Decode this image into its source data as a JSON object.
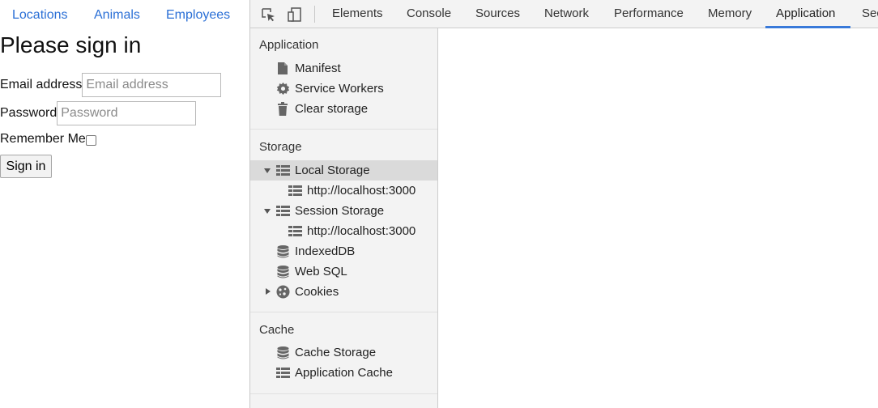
{
  "webpage": {
    "nav": [
      {
        "label": "Locations"
      },
      {
        "label": "Animals"
      },
      {
        "label": "Employees"
      }
    ],
    "title": "Please sign in",
    "email": {
      "label": "Email address",
      "placeholder": "Email address"
    },
    "password": {
      "label": "Password",
      "placeholder": "Password"
    },
    "remember": {
      "label": "Remember Me",
      "checked": false
    },
    "signin_label": "Sign in",
    "link_color": "#2a6fd6"
  },
  "devtools": {
    "tabs": [
      "Elements",
      "Console",
      "Sources",
      "Network",
      "Performance",
      "Memory",
      "Application",
      "Sec"
    ],
    "active_tab": "Application",
    "accent_color": "#3879d9",
    "sidebar": {
      "sections": [
        {
          "title": "Application",
          "items": [
            {
              "label": "Manifest",
              "icon": "document-icon"
            },
            {
              "label": "Service Workers",
              "icon": "gear-icon"
            },
            {
              "label": "Clear storage",
              "icon": "trash-icon"
            }
          ]
        },
        {
          "title": "Storage",
          "items": [
            {
              "label": "Local Storage",
              "icon": "table-grid-icon",
              "expanded": true,
              "selected": true
            },
            {
              "label": "http://localhost:3000",
              "icon": "table-grid-icon"
            },
            {
              "label": "Session Storage",
              "icon": "table-grid-icon",
              "expanded": true
            },
            {
              "label": "http://localhost:3000",
              "icon": "table-grid-icon"
            },
            {
              "label": "IndexedDB",
              "icon": "database-icon"
            },
            {
              "label": "Web SQL",
              "icon": "database-icon"
            },
            {
              "label": "Cookies",
              "icon": "cookie-icon",
              "expanded": false
            }
          ]
        },
        {
          "title": "Cache",
          "items": [
            {
              "label": "Cache Storage",
              "icon": "database-icon"
            },
            {
              "label": "Application Cache",
              "icon": "table-grid-icon"
            }
          ]
        }
      ]
    }
  }
}
